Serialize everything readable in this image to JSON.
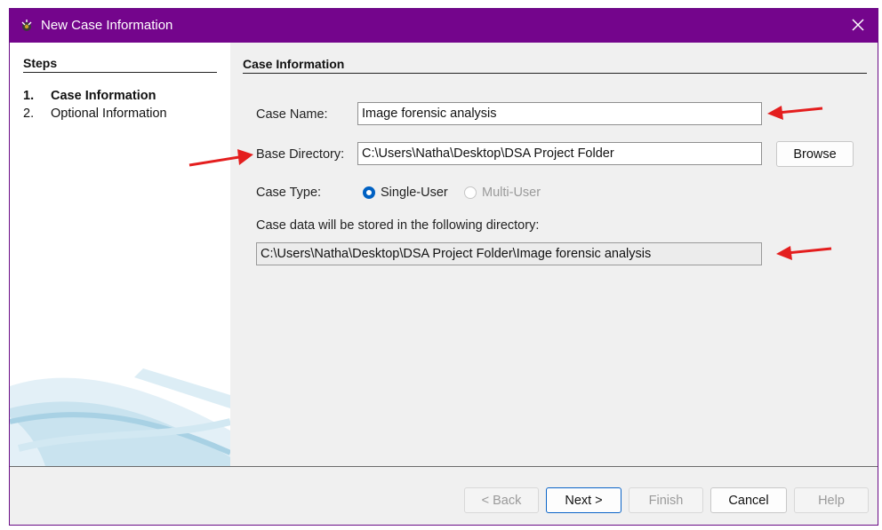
{
  "window": {
    "title": "New Case Information"
  },
  "steps": {
    "title": "Steps",
    "items": [
      {
        "num": "1.",
        "label": "Case Information"
      },
      {
        "num": "2.",
        "label": "Optional Information"
      }
    ]
  },
  "form": {
    "section_title": "Case Information",
    "case_name_label": "Case Name:",
    "case_name_value": "Image forensic analysis",
    "base_dir_label": "Base Directory:",
    "base_dir_value": "C:\\Users\\Natha\\Desktop\\DSA Project Folder",
    "browse_label": "Browse",
    "case_type_label": "Case Type:",
    "single_user_label": "Single-User",
    "multi_user_label": "Multi-User",
    "storage_label": "Case data will be stored in the following directory:",
    "storage_value": "C:\\Users\\Natha\\Desktop\\DSA Project Folder\\Image forensic analysis"
  },
  "buttons": {
    "back": "< Back",
    "next": "Next >",
    "finish": "Finish",
    "cancel": "Cancel",
    "help": "Help"
  },
  "colors": {
    "titlebar": "#74058c",
    "accent": "#0061c3",
    "annotation_arrow": "#e41e1e"
  }
}
